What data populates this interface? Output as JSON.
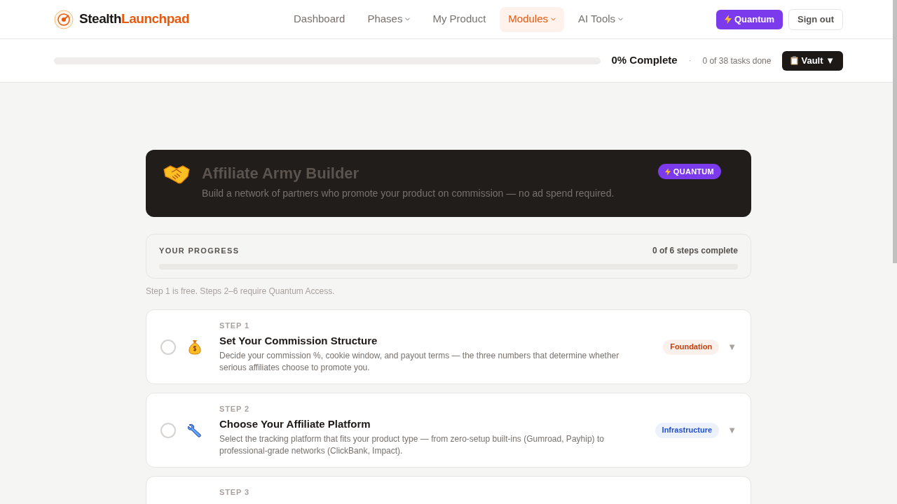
{
  "brand": {
    "part_1": "Stealth",
    "part_2": "Launchpad"
  },
  "nav": [
    {
      "label": "Dashboard",
      "dropdown": false,
      "selected": false
    },
    {
      "label": "Phases",
      "dropdown": true,
      "selected": false
    },
    {
      "label": "My Product",
      "dropdown": false,
      "selected": false
    },
    {
      "label": "Modules",
      "dropdown": true,
      "selected": true
    },
    {
      "label": "AI Tools",
      "dropdown": true,
      "selected": false
    }
  ],
  "quantum_button": "Quantum",
  "sign_out_button": "Sign out",
  "overall_progress": {
    "level": 0,
    "percent_label": "0% Complete",
    "separator": "·",
    "tasks_label": "0 of 38 tasks done",
    "vault_button": "Vault ▼"
  },
  "hero": {
    "title": "Affiliate Army Builder",
    "subtitle": "Build a network of partners who promote your product on commission — no ad spend required.",
    "badge": "QUANTUM"
  },
  "progress_card": {
    "heading": "YOUR PROGRESS",
    "count": "0 of 6 steps complete",
    "level": 0
  },
  "note": "Step 1 is free. Steps 2–6 require Quantum Access.",
  "steps": [
    {
      "kind": "money-bag",
      "step_label": "STEP 1",
      "title": "Set Your Commission Structure",
      "description": "Decide your commission %, cookie window, and payout terms — the three numbers that determine whether serious affiliates choose to promote you.",
      "tag": "Foundation",
      "color": "#c2410c",
      "checked": false,
      "toggle": "▼"
    },
    {
      "kind": "wrench",
      "step_label": "STEP 2",
      "title": "Choose Your Affiliate Platform",
      "description": "Select the tracking platform that fits your product type — from zero-setup built-ins (Gumroad, Payhip) to professional-grade networks (ClickBank, Impact).",
      "tag": "Infrastructure",
      "color": "#1d4ed8",
      "checked": false,
      "toggle": "▼"
    },
    {
      "kind": "hidden",
      "step_label": "STEP 3"
    }
  ]
}
